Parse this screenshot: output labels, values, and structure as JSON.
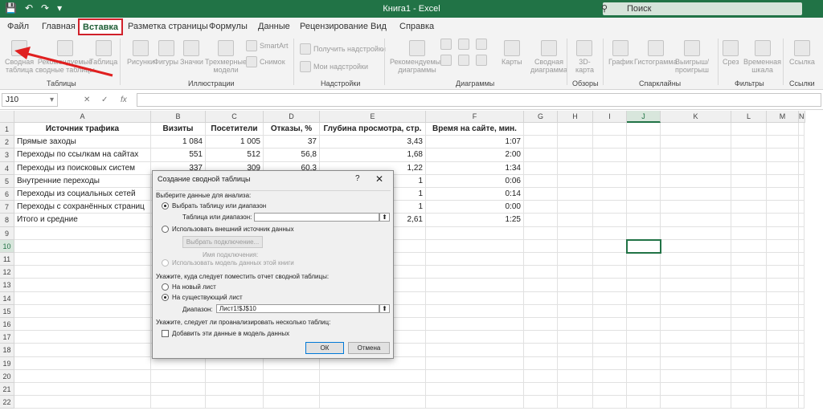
{
  "titlebar": {
    "qat": [
      "💾",
      "↶",
      "↷",
      "▾"
    ],
    "title": "Книга1  -  Excel",
    "search_placeholder": "Поиск",
    "accent": "#217346"
  },
  "tabs": [
    "Файл",
    "Главная",
    "Вставка",
    "Разметка страницы",
    "Формулы",
    "Данные",
    "Рецензирование",
    "Вид",
    "Справка"
  ],
  "active_tab": "Вставка",
  "ribbon": {
    "buttons": {
      "pivot": [
        "Сводная",
        "таблица"
      ],
      "recommended_pivot": [
        "Рекомендуемые",
        "сводные таблицы"
      ],
      "table": [
        "Таблица"
      ],
      "pictures": [
        "Рисунки"
      ],
      "shapes": [
        "Фигуры"
      ],
      "icons": [
        "Значки"
      ],
      "models3d": [
        "Трехмерные",
        "модели"
      ],
      "smartart": "SmartArt",
      "snapshot": "Снимок",
      "get_addins": "Получить надстройки",
      "my_addins": "Мои надстройки",
      "rec_charts": [
        "Рекомендуемые",
        "диаграммы"
      ],
      "maps": [
        "Карты"
      ],
      "pivot_chart": [
        "Сводная",
        "диаграмма"
      ],
      "map3d": [
        "3D-",
        "карта"
      ],
      "spark_line": "График",
      "spark_column": "Гистограмма",
      "spark_winloss": [
        "Выигрыш/",
        "проигрыш"
      ],
      "slicer": "Срез",
      "timeline": [
        "Временная",
        "шкала"
      ],
      "link": "Ссылка"
    },
    "groups": {
      "tables": "Таблицы",
      "illustrations": "Иллюстрации",
      "addins": "Надстройки",
      "charts": "Диаграммы",
      "tours": "Обзоры",
      "sparklines": "Спарклайны",
      "filters": "Фильтры",
      "links": "Ссылки"
    }
  },
  "formula_bar": {
    "namebox": "J10",
    "cancel": "✕",
    "enter": "✓",
    "fx": "fx"
  },
  "sheet": {
    "columns": [
      "A",
      "B",
      "C",
      "D",
      "E",
      "F",
      "G",
      "H",
      "I",
      "J",
      "K",
      "L",
      "M",
      "N"
    ],
    "rows": [
      "1",
      "2",
      "3",
      "4",
      "5",
      "6",
      "7",
      "8",
      "9",
      "10",
      "11",
      "12",
      "13",
      "14",
      "15",
      "16",
      "17",
      "18",
      "19",
      "20",
      "21",
      "22"
    ],
    "selected_cell": "J10",
    "header": [
      "Источник трафика",
      "Визиты",
      "Посетители",
      "Отказы, %",
      "Глубина просмотра, стр.",
      "Время на сайте, мин."
    ],
    "data": [
      [
        "Прямые заходы",
        "1 084",
        "1 005",
        "37",
        "3,43",
        "1:07"
      ],
      [
        "Переходы по ссылкам на сайтах",
        "551",
        "512",
        "56,8",
        "1,68",
        "2:00"
      ],
      [
        "Переходы из поисковых систем",
        "337",
        "309",
        "60,3",
        "1,22",
        "1:34"
      ],
      [
        "Внутренние переходы",
        "",
        "",
        "",
        "1",
        "0:06"
      ],
      [
        "Переходы из социальных сетей",
        "",
        "",
        "",
        "1",
        "0:14"
      ],
      [
        "Переходы с сохранённых страниц",
        "",
        "",
        "",
        "1",
        "0:00"
      ],
      [
        "Итого и средние",
        "",
        "",
        "",
        "2,61",
        "1:25"
      ]
    ]
  },
  "dialog": {
    "title": "Создание сводной таблицы",
    "help": "?",
    "close": "✕",
    "section1": "Выберите данные для анализа:",
    "opt_table": "Выбрать таблицу или диапазон",
    "table_range_label": "Таблица или диапазон:",
    "table_range_value": "",
    "opt_external": "Использовать внешний источник данных",
    "choose_connection": "Выбрать подключение...",
    "connection_name": "Имя подключения:",
    "opt_datamodel": "Использовать модель данных этой книги",
    "section2": "Укажите, куда следует поместить отчет сводной таблицы:",
    "opt_new_sheet": "На новый лист",
    "opt_existing_sheet": "На существующий лист",
    "location_label": "Диапазон:",
    "location_value": "Лист1!$J$10",
    "section3": "Укажите, следует ли проанализировать несколько таблиц:",
    "add_to_model": "Добавить эти данные в модель данных",
    "ok": "ОК",
    "cancel": "Отмена",
    "ref_icon": "⬆"
  }
}
